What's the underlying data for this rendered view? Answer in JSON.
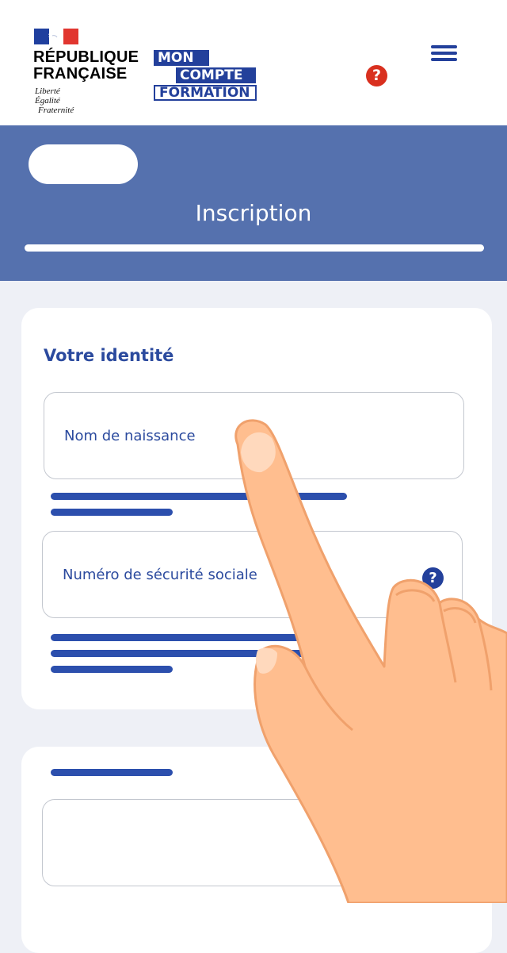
{
  "header": {
    "republic": {
      "line1": "RÉPUBLIQUE",
      "line2": "FRANÇAISE"
    },
    "motto": [
      "Liberté",
      "Égalité",
      "Fraternité"
    ],
    "brand_logo": {
      "line1": "MON",
      "line2": "COMPTE",
      "line3": "FORMATION"
    },
    "help_icon_text": "?",
    "colors": {
      "flag_blue": "#1f3f9e",
      "flag_red": "#e1362f",
      "brand_blue": "#23409b",
      "help_red": "#d9301f"
    }
  },
  "banner": {
    "title": "Inscription",
    "progress": 1.0,
    "background": "#5571ae"
  },
  "identity_card": {
    "title": "Votre identité",
    "fields": [
      {
        "label": "Nom de naissance",
        "value": ""
      },
      {
        "label": "Numéro de sécurité sociale",
        "value": "",
        "help_icon_text": "?"
      }
    ]
  },
  "second_card": {
    "fields": [
      {
        "label": "",
        "value": ""
      }
    ]
  }
}
